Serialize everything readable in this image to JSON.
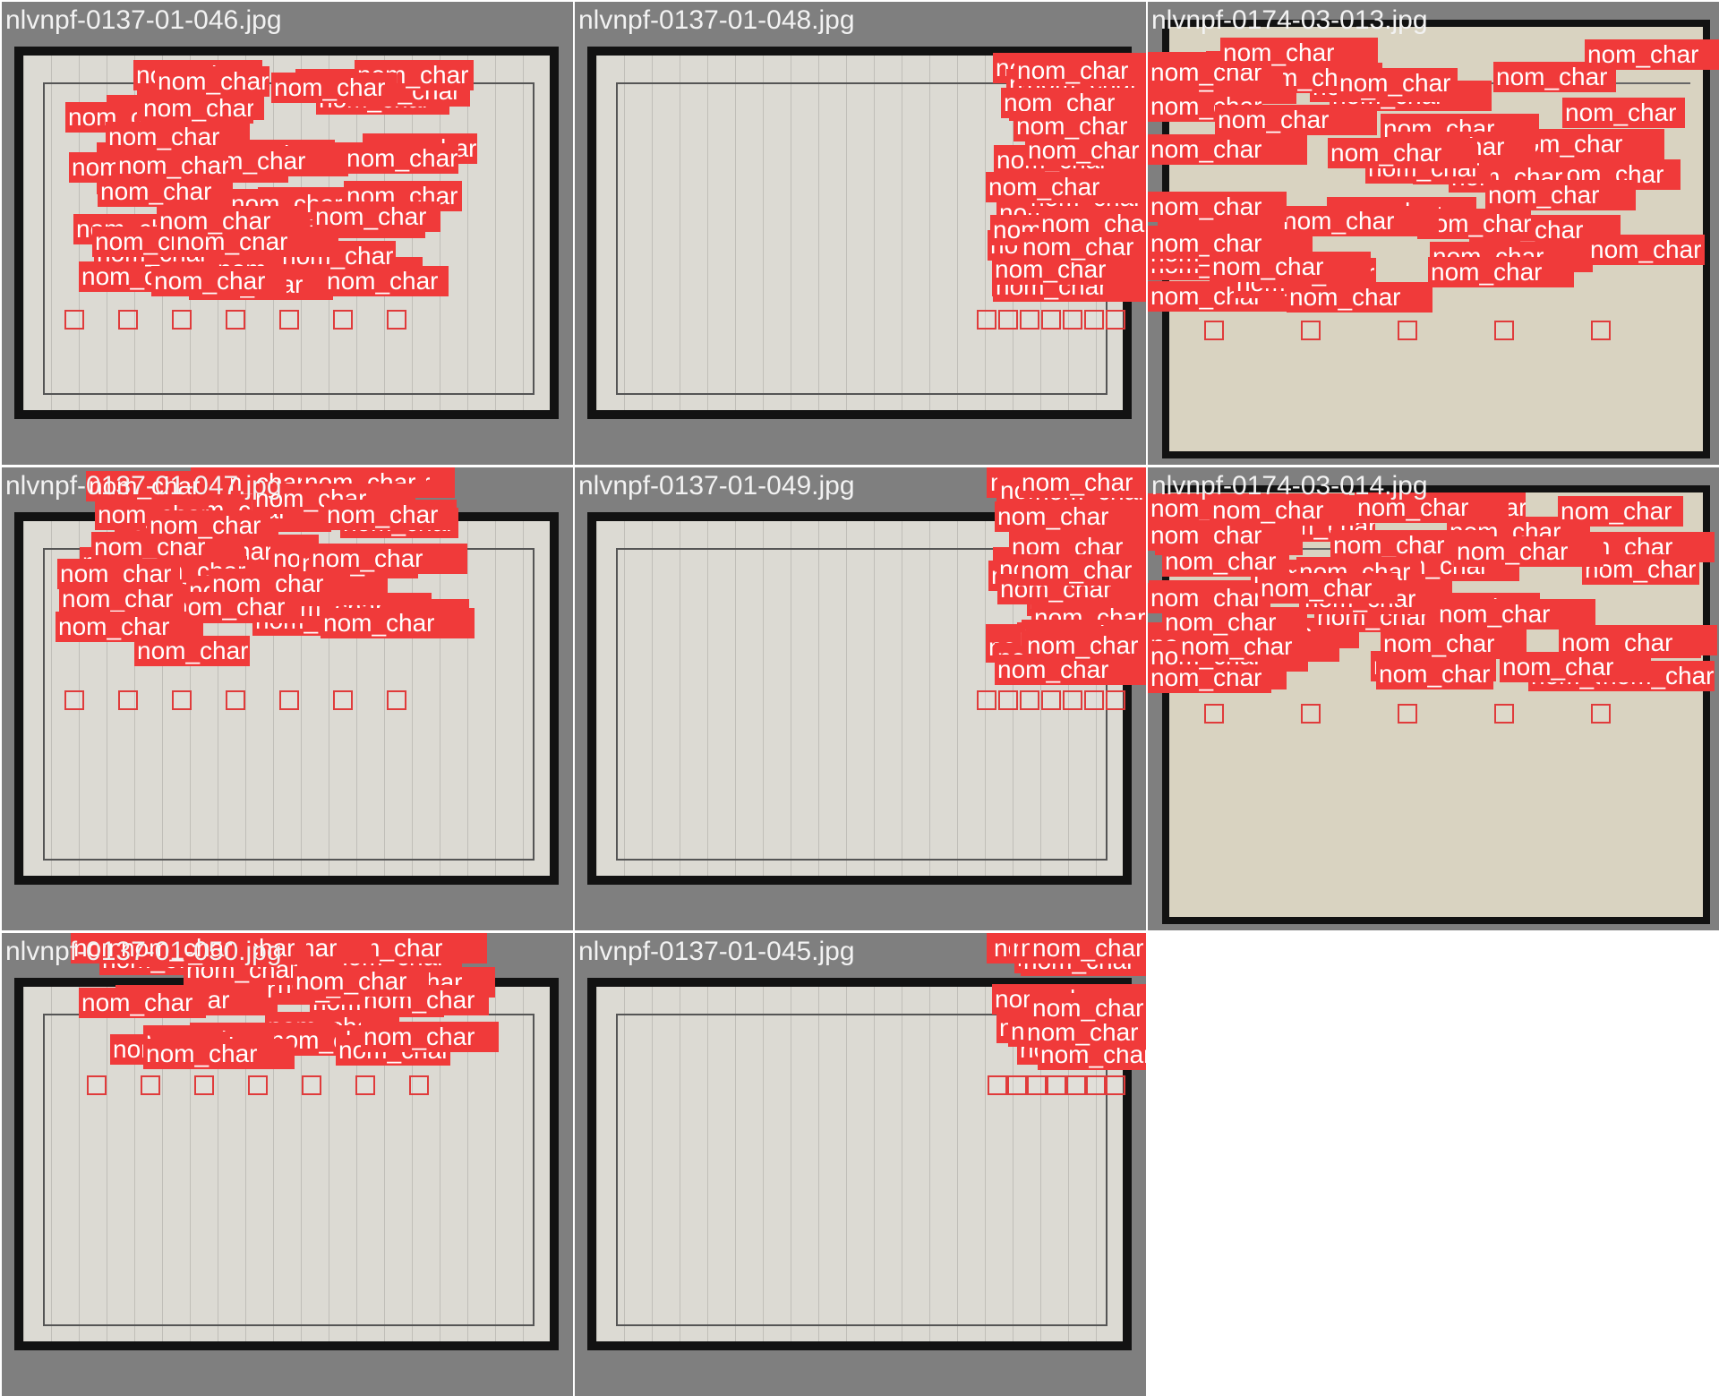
{
  "colors": {
    "tile_bg": "#7f7f7f",
    "label_bg": "#f03a3a",
    "label_text": "#ffffff",
    "box": "#e03b3b"
  },
  "label_text": "nom_char",
  "tiles": [
    {
      "title": "nlvnpf-0137-01-046.jpg",
      "labels": 42
    },
    {
      "title": "nlvnpf-0137-01-048.jpg",
      "labels": 44
    },
    {
      "title": "nlvnpf-0174-03-013.jpg",
      "labels": 46
    },
    {
      "title": "nlvnpf-0137-01-047.jpg",
      "labels": 42
    },
    {
      "title": "nlvnpf-0137-01-049.jpg",
      "labels": 44
    },
    {
      "title": "nlvnpf-0174-03-014.jpg",
      "labels": 44
    },
    {
      "title": "nlvnpf-0137-01-050.jpg",
      "labels": 42
    },
    {
      "title": "nlvnpf-0137-01-045.jpg",
      "labels": 44
    }
  ]
}
